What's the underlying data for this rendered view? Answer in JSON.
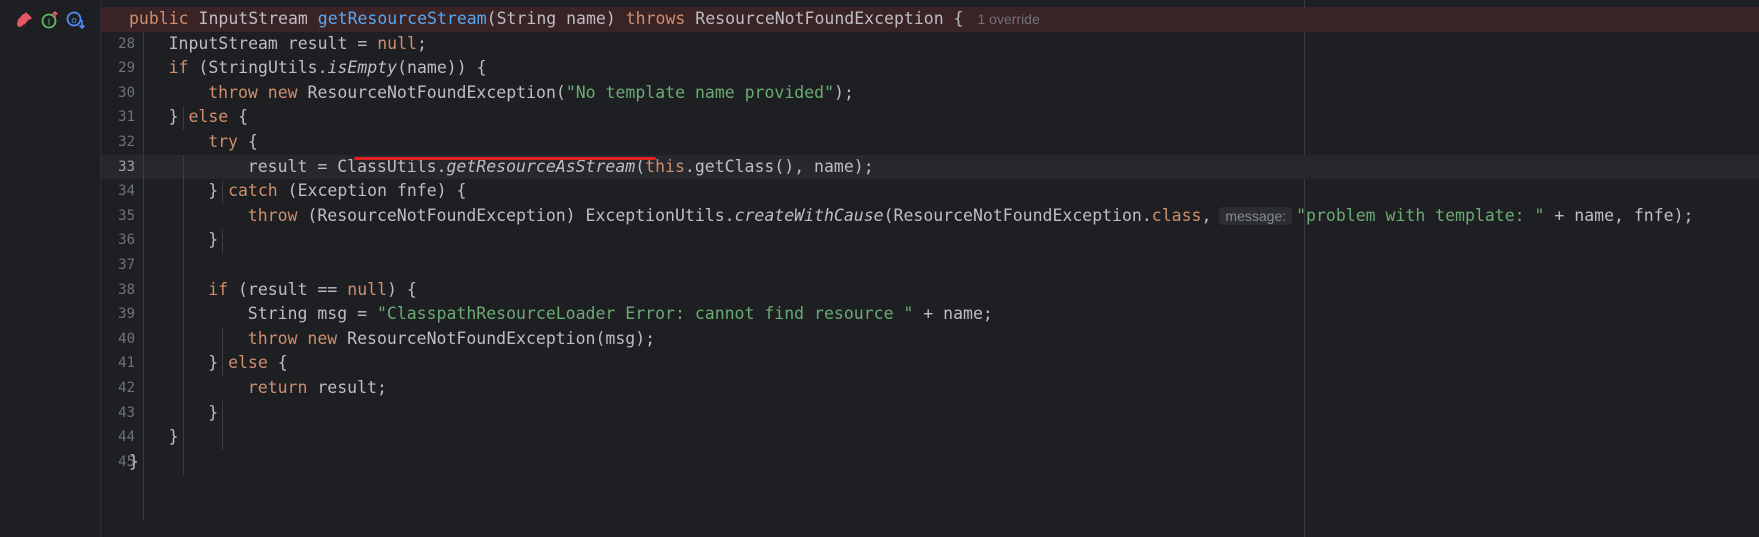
{
  "editor": {
    "gutter_icons": [
      "breakpoint-icon",
      "implementing-method-icon",
      "overriding-method-icon"
    ],
    "lines": [
      {
        "number": "",
        "tokens": [
          {
            "t": "public ",
            "c": "kw"
          },
          {
            "t": "InputStream "
          },
          {
            "t": "getResourceStream",
            "c": "fn"
          },
          {
            "t": "(String name) "
          },
          {
            "t": "throws ",
            "c": "kw"
          },
          {
            "t": "ResourceNotFoundException {"
          }
        ],
        "hint": "1 override"
      },
      {
        "number": "28",
        "tokens": [
          {
            "t": "InputStream result = "
          },
          {
            "t": "null",
            "c": "kw"
          },
          {
            "t": ";"
          }
        ]
      },
      {
        "number": "29",
        "tokens": [
          {
            "t": "if ",
            "c": "kw"
          },
          {
            "t": "(StringUtils."
          },
          {
            "t": "isEmpty",
            "c": "it"
          },
          {
            "t": "(name)) {"
          }
        ]
      },
      {
        "number": "30",
        "tokens": [
          {
            "t": "throw new ",
            "c": "kw"
          },
          {
            "t": "ResourceNotFoundException("
          },
          {
            "t": "\"No template name provided\"",
            "c": "str"
          },
          {
            "t": ");"
          }
        ]
      },
      {
        "number": "31",
        "tokens": [
          {
            "t": "} "
          },
          {
            "t": "else ",
            "c": "kw"
          },
          {
            "t": "{"
          }
        ]
      },
      {
        "number": "32",
        "tokens": [
          {
            "t": "try ",
            "c": "kw"
          },
          {
            "t": "{"
          }
        ]
      },
      {
        "number": "33",
        "tokens": [
          {
            "t": "result = ClassUtils."
          },
          {
            "t": "getResourceAsStream",
            "c": "it"
          },
          {
            "t": "("
          },
          {
            "t": "this",
            "c": "kw"
          },
          {
            "t": ".getClass(), name);"
          }
        ]
      },
      {
        "number": "34",
        "tokens": [
          {
            "t": "} "
          },
          {
            "t": "catch ",
            "c": "kw"
          },
          {
            "t": "(Exception fnfe) {"
          }
        ]
      },
      {
        "number": "35",
        "tokens": [
          {
            "t": "throw ",
            "c": "kw"
          },
          {
            "t": "(ResourceNotFoundException) ExceptionUtils."
          },
          {
            "t": "createWithCause",
            "c": "it"
          },
          {
            "t": "(ResourceNotFoundException."
          },
          {
            "t": "class",
            "c": "kw"
          },
          {
            "t": ","
          },
          {
            "hint": "message:"
          },
          {
            "t": "\"problem with template: \"",
            "c": "str"
          },
          {
            "t": " + name, fnfe);"
          }
        ]
      },
      {
        "number": "36",
        "tokens": [
          {
            "t": "}"
          }
        ]
      },
      {
        "number": "37",
        "tokens": []
      },
      {
        "number": "38",
        "tokens": [
          {
            "t": "if ",
            "c": "kw"
          },
          {
            "t": "(result == "
          },
          {
            "t": "null",
            "c": "kw"
          },
          {
            "t": ") {"
          }
        ]
      },
      {
        "number": "39",
        "tokens": [
          {
            "t": "String msg = "
          },
          {
            "t": "\"ClasspathResourceLoader Error: cannot find resource \"",
            "c": "str"
          },
          {
            "t": " + name;"
          }
        ]
      },
      {
        "number": "40",
        "tokens": [
          {
            "t": "throw new ",
            "c": "kw"
          },
          {
            "t": "ResourceNotFoundException(msg);"
          }
        ]
      },
      {
        "number": "41",
        "tokens": [
          {
            "t": "} "
          },
          {
            "t": "else ",
            "c": "kw"
          },
          {
            "t": "{"
          }
        ]
      },
      {
        "number": "42",
        "tokens": [
          {
            "t": "return ",
            "c": "kw"
          },
          {
            "t": "result;"
          }
        ]
      },
      {
        "number": "43",
        "tokens": [
          {
            "t": "}"
          }
        ]
      },
      {
        "number": "44",
        "tokens": [
          {
            "t": "}"
          }
        ]
      },
      {
        "number": "45",
        "tokens": [
          {
            "t": "}"
          }
        ]
      }
    ],
    "colors": {
      "background": "#1e1f22",
      "keyword": "#cf8e6d",
      "method": "#56a8f5",
      "string": "#6aab73",
      "breakpoint_line": "#3a2325",
      "error_underline": "#e52020"
    }
  }
}
